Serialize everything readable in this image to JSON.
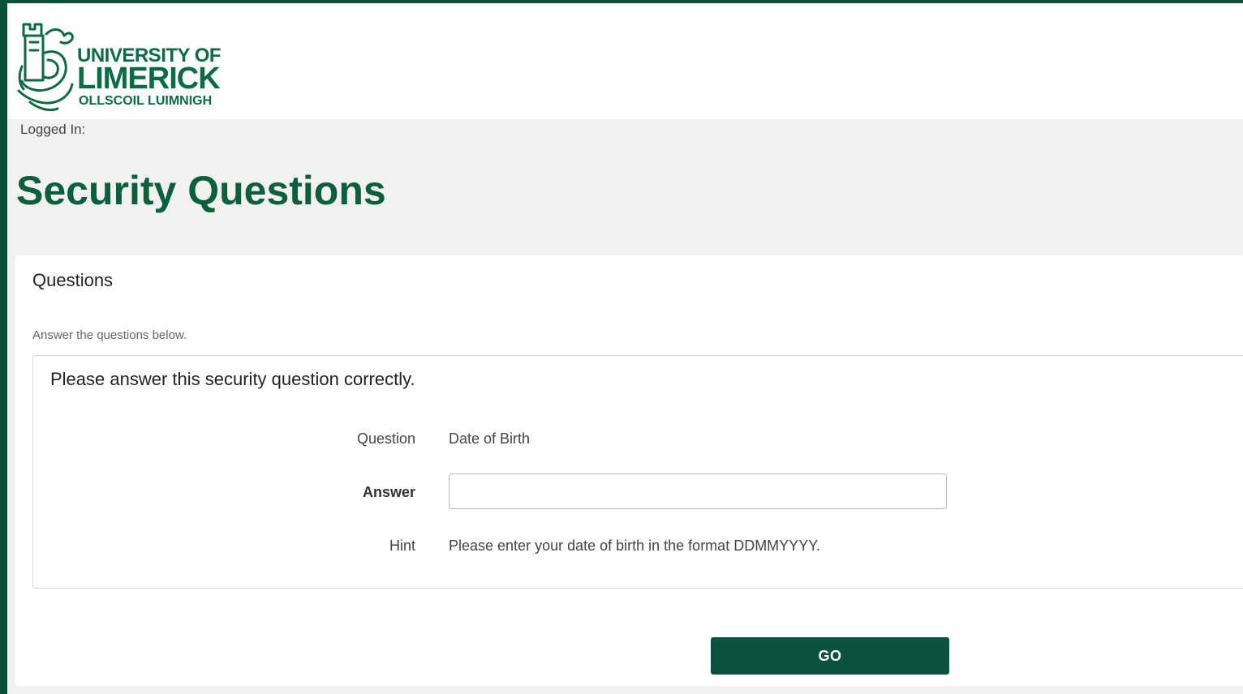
{
  "brand": {
    "logo_line1": "UNIVERSITY OF",
    "logo_line2": "LIMERICK",
    "logo_line3": "OLLSCOIL LUIMNIGH",
    "color": "#0a5f3e"
  },
  "header": {
    "logged_in": "Logged In:"
  },
  "page": {
    "title": "Security Questions"
  },
  "panel": {
    "title": "Questions",
    "instructions": "Answer the questions below."
  },
  "question_box": {
    "title": "Please answer this security question correctly.",
    "question_label": "Question",
    "question_value": "Date of Birth",
    "answer_label": "Answer",
    "answer_value": "",
    "hint_label": "Hint",
    "hint_value": "Please enter your date of birth in the format DDMMYYYY."
  },
  "actions": {
    "go_label": "GO"
  },
  "colors": {
    "accent": "#0a5240",
    "background": "#f1f1f1",
    "frame": "#0a4f3a"
  }
}
